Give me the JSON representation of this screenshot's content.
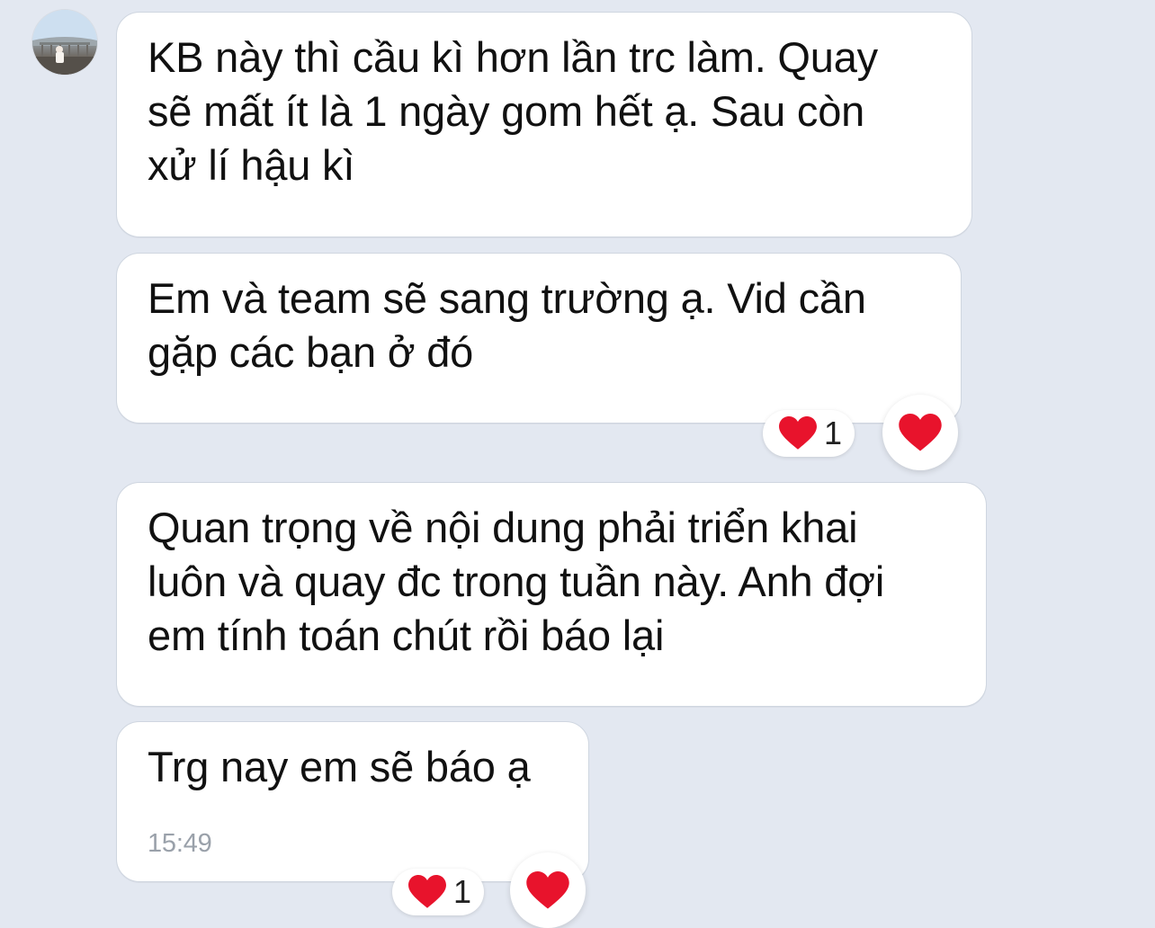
{
  "messages": [
    {
      "text": "KB này thì cầu kì hơn lần trc làm. Quay\nsẽ mất ít là 1 ngày gom hết ạ. Sau còn\nxử lí hậu kì"
    },
    {
      "text": "Em và team sẽ sang trường ạ. Vid cần\ngặp các bạn ở đó",
      "reaction": {
        "icon": "heart-icon",
        "count": "1"
      }
    },
    {
      "text": "Quan trọng về nội dung phải triển khai\nluôn và quay đc trong tuần này. Anh đợi\nem tính toán chút rồi báo lại"
    },
    {
      "text": "Trg nay em sẽ báo ạ",
      "time": "15:49",
      "reaction": {
        "icon": "heart-icon",
        "count": "1"
      }
    }
  ],
  "colors": {
    "background": "#e3e8f1",
    "bubble": "#ffffff",
    "heart": "#e8132c",
    "timestamp": "#9aa1aa"
  }
}
